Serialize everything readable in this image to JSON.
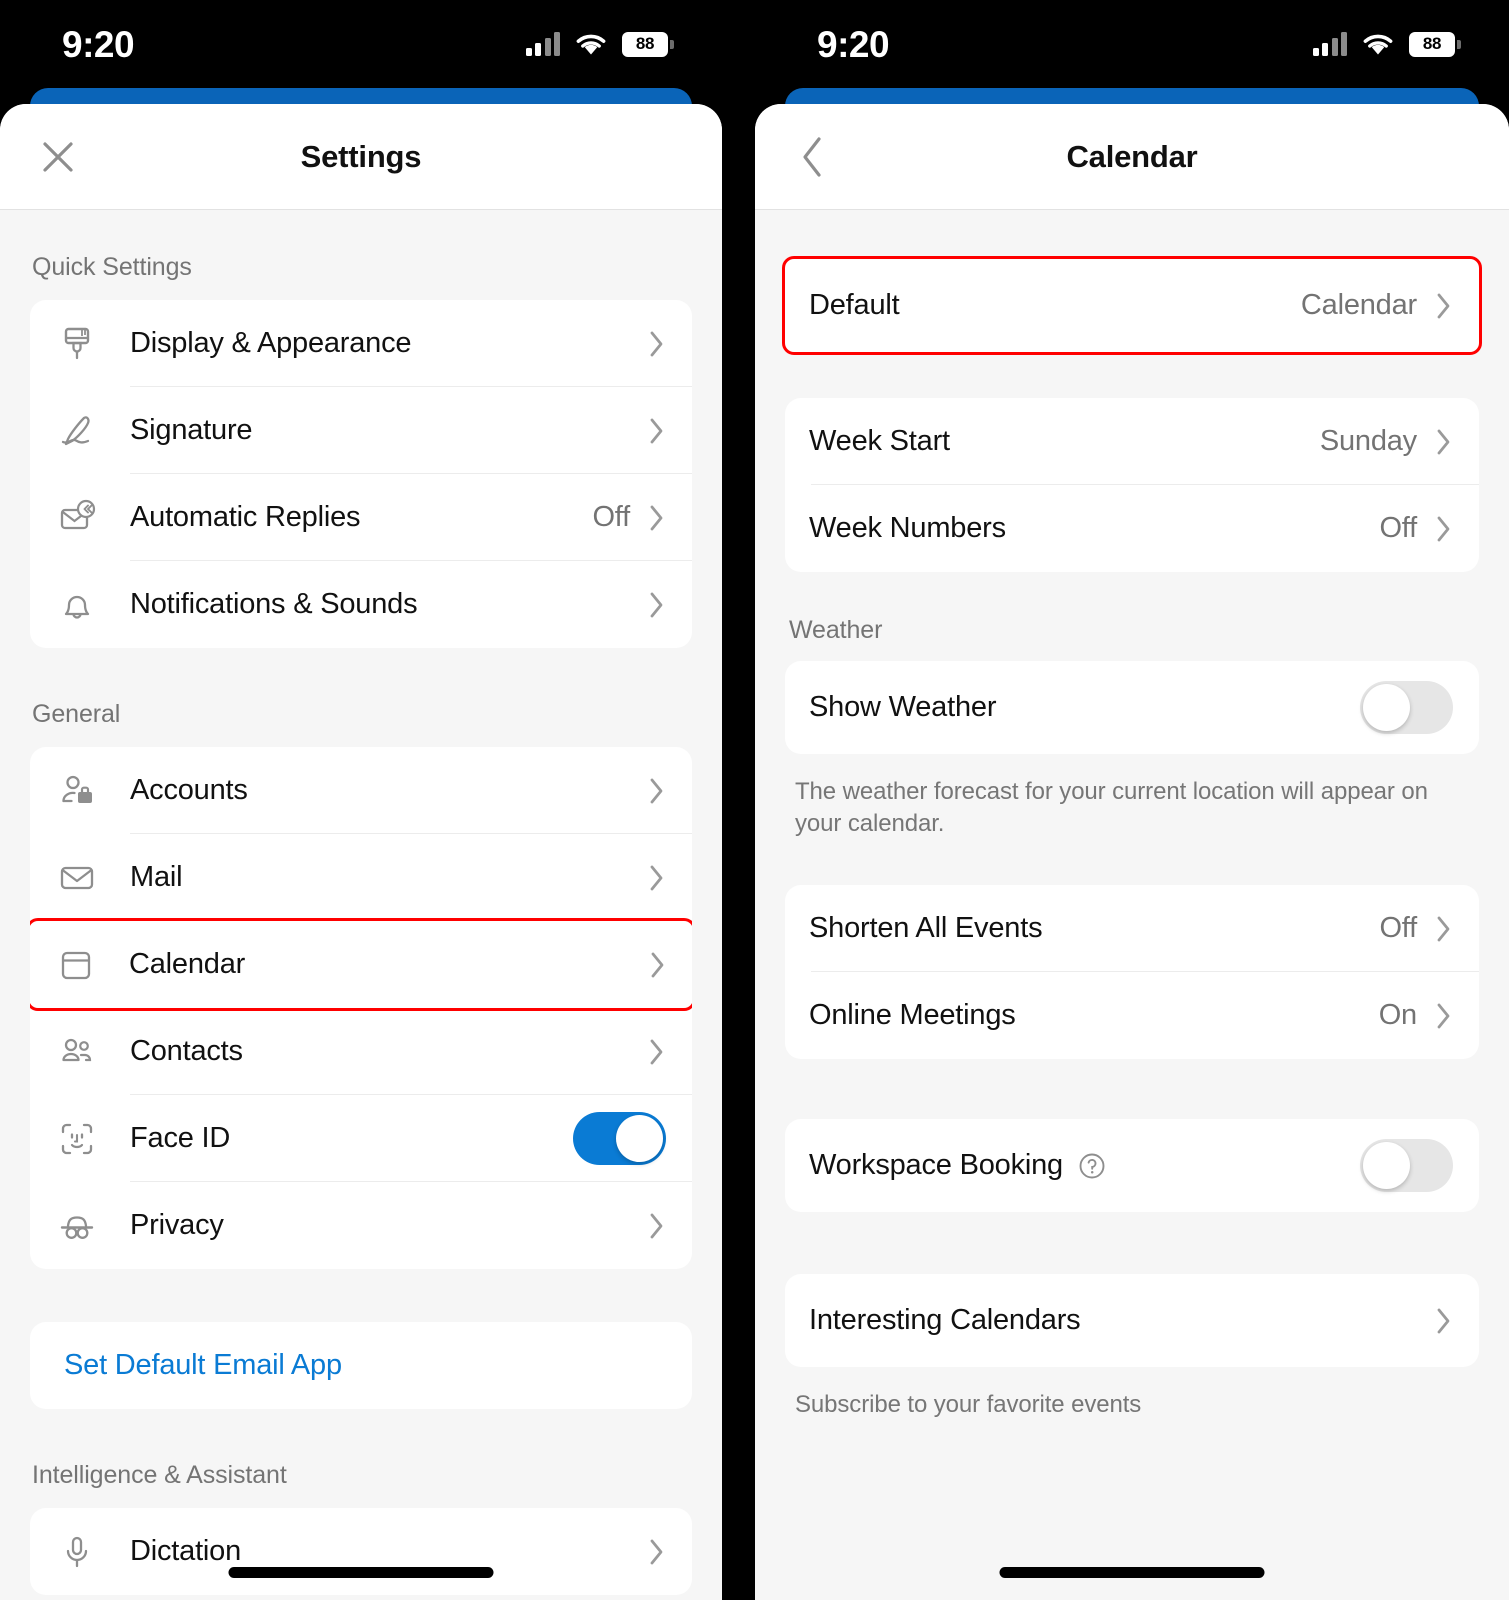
{
  "status_bar": {
    "time": "9:20",
    "battery_level": "88",
    "signal_icon": "cellular-signal-icon",
    "wifi_icon": "wifi-icon",
    "battery_icon": "battery-icon"
  },
  "left_panel": {
    "nav": {
      "title": "Settings",
      "close_icon": "close-icon"
    },
    "sections": [
      {
        "header": "Quick Settings",
        "rows": [
          {
            "label": "Display & Appearance",
            "icon": "paintbrush-icon",
            "value": "",
            "accessory": "chevron"
          },
          {
            "label": "Signature",
            "icon": "signature-pen-icon",
            "value": "",
            "accessory": "chevron"
          },
          {
            "label": "Automatic Replies",
            "icon": "automatic-replies-icon",
            "value": "Off",
            "accessory": "chevron"
          },
          {
            "label": "Notifications & Sounds",
            "icon": "bell-icon",
            "value": "",
            "accessory": "chevron"
          }
        ]
      },
      {
        "header": "General",
        "rows": [
          {
            "label": "Accounts",
            "icon": "account-briefcase-icon",
            "value": "",
            "accessory": "chevron"
          },
          {
            "label": "Mail",
            "icon": "envelope-icon",
            "value": "",
            "accessory": "chevron"
          },
          {
            "label": "Calendar",
            "icon": "calendar-icon",
            "value": "",
            "accessory": "chevron",
            "highlighted": true
          },
          {
            "label": "Contacts",
            "icon": "contacts-icon",
            "value": "",
            "accessory": "chevron"
          },
          {
            "label": "Face ID",
            "icon": "face-id-icon",
            "value": "",
            "accessory": "toggle",
            "toggle_on": true
          },
          {
            "label": "Privacy",
            "icon": "privacy-hat-icon",
            "value": "",
            "accessory": "chevron"
          }
        ]
      },
      {
        "header": "",
        "link_label": "Set Default Email App"
      },
      {
        "header": "Intelligence & Assistant",
        "rows": [
          {
            "label": "Dictation",
            "icon": "microphone-icon",
            "value": "",
            "accessory": "chevron"
          }
        ]
      }
    ]
  },
  "right_panel": {
    "nav": {
      "title": "Calendar",
      "back_icon": "chevron-left-icon"
    },
    "sections": [
      {
        "header": "",
        "rows": [
          {
            "label": "Default",
            "value": "Calendar",
            "accessory": "chevron",
            "highlighted": true
          }
        ]
      },
      {
        "header": "",
        "rows": [
          {
            "label": "Week Start",
            "value": "Sunday",
            "accessory": "chevron"
          },
          {
            "label": "Week Numbers",
            "value": "Off",
            "accessory": "chevron"
          }
        ]
      },
      {
        "header": "Weather",
        "rows": [
          {
            "label": "Show Weather",
            "value": "",
            "accessory": "toggle",
            "toggle_on": false
          }
        ],
        "footnote": "The weather forecast for your current location will appear on your calendar."
      },
      {
        "header": "",
        "rows": [
          {
            "label": "Shorten All Events",
            "value": "Off",
            "accessory": "chevron"
          },
          {
            "label": "Online Meetings",
            "value": "On",
            "accessory": "chevron"
          }
        ]
      },
      {
        "header": "",
        "rows": [
          {
            "label": "Workspace Booking",
            "value": "",
            "accessory": "toggle",
            "toggle_on": false,
            "help_icon": "help-circle-icon"
          }
        ]
      },
      {
        "header": "",
        "rows": [
          {
            "label": "Interesting Calendars",
            "value": "",
            "accessory": "chevron"
          }
        ],
        "footnote": "Subscribe to your favorite events"
      }
    ]
  },
  "colors": {
    "accent_blue": "#0a7bd4",
    "header_blue": "#0a64b8",
    "highlight_red": "#ff0000",
    "link_blue": "#0a7bd4",
    "page_bg": "#f6f6f6",
    "card_bg": "#ffffff",
    "secondary_text": "#737373"
  }
}
